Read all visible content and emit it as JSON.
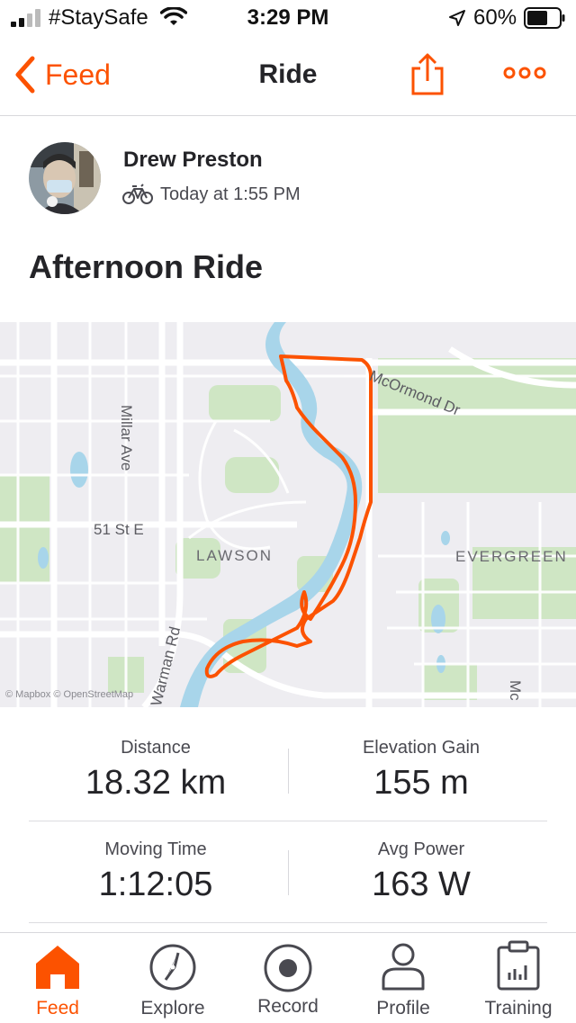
{
  "status_bar": {
    "carrier": "#StaySafe",
    "time": "3:29 PM",
    "battery": "60%"
  },
  "nav": {
    "back_label": "Feed",
    "title": "Ride"
  },
  "athlete": {
    "name": "Drew Preston",
    "timestamp": "Today at 1:55 PM"
  },
  "activity": {
    "title": "Afternoon Ride"
  },
  "map": {
    "labels": {
      "millar": "Millar Ave",
      "street51": "51 St E",
      "lawson": "LAWSON",
      "mcormond": "McOrmond Dr",
      "evergreen": "EVERGREEN",
      "warman": "Warman Rd",
      "mc": "Mc",
      "attribution": "© Mapbox © OpenStreetMap"
    },
    "route_color": "#fc5200",
    "river_color": "#a8d5ea"
  },
  "stats": [
    {
      "label": "Distance",
      "value": "18.32 km"
    },
    {
      "label": "Elevation Gain",
      "value": "155 m"
    },
    {
      "label": "Moving Time",
      "value": "1:12:05"
    },
    {
      "label": "Avg Power",
      "value": "163 W"
    }
  ],
  "tabs": [
    {
      "label": "Feed",
      "icon": "home-icon",
      "active": true
    },
    {
      "label": "Explore",
      "icon": "compass-icon",
      "active": false
    },
    {
      "label": "Record",
      "icon": "record-icon",
      "active": false
    },
    {
      "label": "Profile",
      "icon": "profile-icon",
      "active": false
    },
    {
      "label": "Training",
      "icon": "training-icon",
      "active": false
    }
  ],
  "colors": {
    "accent": "#fc5200",
    "text_primary": "#242428",
    "text_secondary": "#494950"
  }
}
